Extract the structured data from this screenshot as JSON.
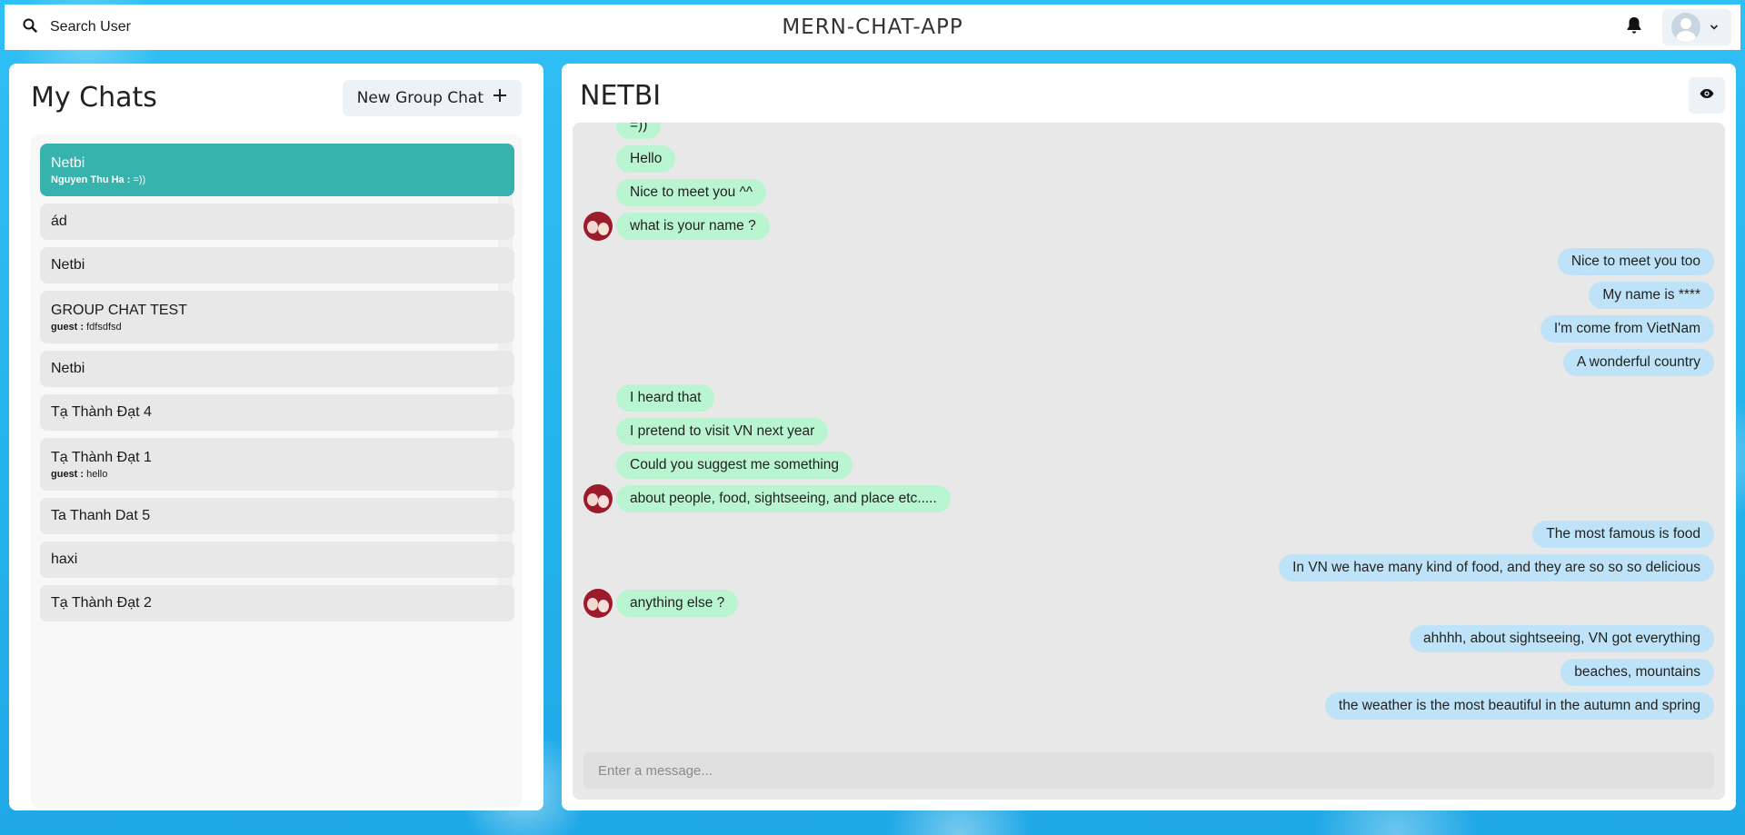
{
  "header": {
    "search_label": "Search User",
    "app_title": "MERN-CHAT-APP"
  },
  "sidebar": {
    "title": "My Chats",
    "new_group_label": "New Group Chat",
    "chats": [
      {
        "name": "Netbi",
        "latest_sender": "Nguyen Thu Ha :",
        "latest_message": "=))",
        "active": true
      },
      {
        "name": "ád"
      },
      {
        "name": "Netbi"
      },
      {
        "name": "GROUP CHAT TEST",
        "latest_sender": "guest :",
        "latest_message": "fdfsdfsd"
      },
      {
        "name": "Netbi"
      },
      {
        "name": "Tạ Thành Đạt 4"
      },
      {
        "name": "Tạ Thành Đạt 1",
        "latest_sender": "guest :",
        "latest_message": "hello"
      },
      {
        "name": "Ta Thanh Dat 5"
      },
      {
        "name": "haxi"
      },
      {
        "name": "Tạ Thành Đạt 2"
      }
    ]
  },
  "chat": {
    "title": "NETBI",
    "input_placeholder": "Enter a message...",
    "messages": [
      {
        "text": "=))",
        "side": "left",
        "avatar": false
      },
      {
        "text": "Hello",
        "side": "left",
        "avatar": false
      },
      {
        "text": "Nice to meet you ^^",
        "side": "left",
        "avatar": false
      },
      {
        "text": "what is your name ?",
        "side": "left",
        "avatar": true
      },
      {
        "text": "Nice to meet you too",
        "side": "right"
      },
      {
        "text": "My name is ****",
        "side": "right"
      },
      {
        "text": "I'm come from VietNam",
        "side": "right"
      },
      {
        "text": "A wonderful country",
        "side": "right"
      },
      {
        "text": "I heard that",
        "side": "left",
        "avatar": false
      },
      {
        "text": "I pretend to visit VN next year",
        "side": "left",
        "avatar": false
      },
      {
        "text": "Could you suggest me something",
        "side": "left",
        "avatar": false
      },
      {
        "text": "about people, food, sightseeing, and place etc.....",
        "side": "left",
        "avatar": true
      },
      {
        "text": "The most famous is food",
        "side": "right"
      },
      {
        "text": "In VN we have many kind of food, and they are so so so delicious",
        "side": "right"
      },
      {
        "text": "anything else ?",
        "side": "left",
        "avatar": true
      },
      {
        "text": "ahhhh, about sightseeing, VN got everything",
        "side": "right"
      },
      {
        "text": "beaches, mountains",
        "side": "right"
      },
      {
        "text": "the weather is the most beautiful in the autumn and spring",
        "side": "right"
      }
    ]
  },
  "colors": {
    "active_chat": "#38b2ac",
    "my_bubble": "#bee3f8",
    "their_bubble": "#b9f5d0",
    "background": "#2ab6f0"
  },
  "icons": {
    "search": "search-icon",
    "bell": "bell-icon",
    "chevron": "chevron-down-icon",
    "plus": "plus-icon",
    "eye": "eye-icon"
  }
}
